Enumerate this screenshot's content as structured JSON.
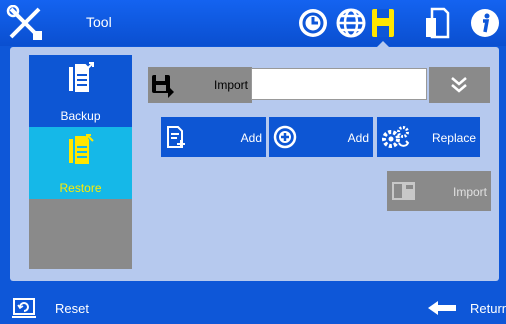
{
  "header": {
    "title": "Tool",
    "icons": [
      "tool-icon",
      "clock-icon",
      "globe-icon",
      "storage-icon",
      "document-icon",
      "info-icon"
    ],
    "active": "storage-icon"
  },
  "sidebar": {
    "items": [
      {
        "label": "Backup",
        "icon": "backup-document-icon",
        "state": "normal"
      },
      {
        "label": "Restore",
        "icon": "restore-document-icon",
        "state": "selected"
      }
    ]
  },
  "main": {
    "import_row": {
      "label": "Import",
      "input_value": "",
      "dropdown_icon": "double-chevron-down-icon"
    },
    "buttons": [
      {
        "label": "Add",
        "icon": "add-document-icon"
      },
      {
        "label": "Add",
        "icon": "plus-circle-icon"
      },
      {
        "label": "Replace",
        "icon": "gears-icon"
      },
      {
        "label": "Import",
        "icon": "import-icon",
        "state": "disabled"
      }
    ]
  },
  "footer": {
    "reset_label": "Reset",
    "return_label": "Return"
  },
  "colors": {
    "bar_blue": "#0e57d8",
    "panel_bg": "#b6c9ee",
    "selected": "#15b8e8",
    "selected_text": "#ffeb00",
    "disabled_gray": "#8a8a8a"
  }
}
